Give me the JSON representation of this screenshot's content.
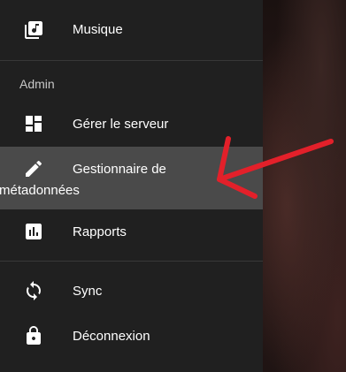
{
  "menu": {
    "music": {
      "label": "Musique",
      "icon": "music-note-icon"
    },
    "admin_heading": "Admin",
    "manage_server": {
      "label": "Gérer le serveur",
      "icon": "dashboard-icon"
    },
    "metadata_manager": {
      "label_line1": "Gestionnaire de",
      "label_line2": "métadonnées",
      "icon": "pencil-icon"
    },
    "reports": {
      "label": "Rapports",
      "icon": "bar-chart-icon"
    },
    "sync": {
      "label": "Sync",
      "icon": "sync-icon"
    },
    "logout": {
      "label": "Déconnexion",
      "icon": "lock-icon"
    }
  },
  "colors": {
    "drawer_bg": "#202020",
    "active_bg": "#4a4a4a",
    "annotation_arrow": "#e3202a"
  }
}
